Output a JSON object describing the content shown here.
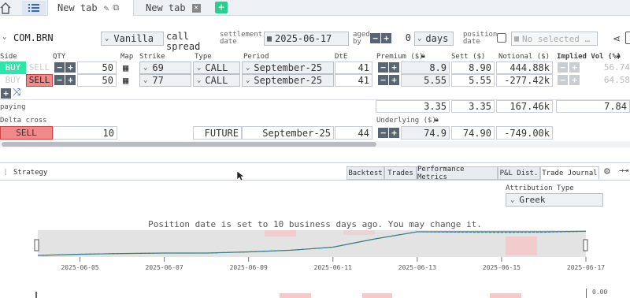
{
  "tabs": [
    {
      "label": "New tab"
    },
    {
      "label": "New tab"
    }
  ],
  "header": {
    "symbol": "COM.BRN",
    "strategy_type": "Vanilla",
    "strategy_name": "call spread",
    "settlement_label": "settlement date",
    "settlement_date": "2025-06-17",
    "aged_label": "aged by",
    "aged_value": "0",
    "aged_unit": "days",
    "position_label": "position date",
    "position_placeholder": "No selected …"
  },
  "columns": {
    "side": "Side",
    "qty": "QTY",
    "map": "Map",
    "strike": "Strike",
    "type": "Type",
    "period": "Period",
    "dte": "DtE",
    "premium": "Premium ($)",
    "sett": "Sett ($)",
    "notional": "Notional ($)",
    "implied_vol": "Implied Vol (%)"
  },
  "legs": [
    {
      "buy": "BUY",
      "sell": "SELL",
      "qty": "50",
      "strike": "69",
      "type": "CALL",
      "period": "September-25",
      "dte": "41",
      "premium": "8.9",
      "sett": "8.90",
      "notional": "444.88k",
      "iv": "56.74"
    },
    {
      "buy": "BUY",
      "sell": "SELL",
      "qty": "50",
      "strike": "77",
      "type": "CALL",
      "period": "September-25",
      "dte": "41",
      "premium": "5.55",
      "sett": "5.55",
      "notional": "-277.42k",
      "iv": "64.58"
    }
  ],
  "summary": {
    "label": "paying",
    "premium": "3.35",
    "sett": "3.35",
    "notional": "167.46k",
    "iv": "7.84"
  },
  "delta": {
    "label": "Delta cross",
    "side": "SELL",
    "qty": "10",
    "type": "FUTURE",
    "period": "September-25",
    "dte": "44",
    "underlying_label": "Underlying ($)",
    "underlying": "74.9",
    "sett": "74.90",
    "notional": "-749.00k"
  },
  "bottom": {
    "section_title": "Strategy",
    "tabs": [
      "Backtest",
      "Trades",
      "Performance Metrics",
      "P&L Dist.",
      "Trade Journal"
    ],
    "active_tab": "Trade Journal",
    "attribution_label": "Attribution Type",
    "attribution_value": "Greek",
    "message": "Position date is set to 10 business days ago. You may change it.",
    "lower_axis_value": "0.00"
  },
  "colors": {
    "buy_active": "#2ee6a8",
    "sell_active": "#f08a8a",
    "accent": "#596573",
    "line_green": "#2f8f3a",
    "line_blue": "#3a6fd0"
  },
  "chart_data": {
    "type": "line",
    "x": [
      "2025-06-04",
      "2025-06-05",
      "2025-06-06",
      "2025-06-07",
      "2025-06-08",
      "2025-06-09",
      "2025-06-10",
      "2025-06-11",
      "2025-06-12",
      "2025-06-13",
      "2025-06-14",
      "2025-06-15",
      "2025-06-16",
      "2025-06-17"
    ],
    "xticks": [
      "2025-06-05",
      "2025-06-07",
      "2025-06-09",
      "2025-06-11",
      "2025-06-13",
      "2025-06-15",
      "2025-06-17"
    ],
    "series": [
      {
        "values": [
          0.0,
          0.05,
          0.08,
          0.1,
          0.1,
          0.15,
          0.22,
          0.35,
          0.7,
          1.0,
          1.0,
          1.0,
          1.0,
          1.02
        ]
      },
      {
        "values": [
          0.0,
          0.05,
          0.08,
          0.1,
          0.1,
          0.15,
          0.22,
          0.35,
          0.7,
          1.0,
          0.98,
          0.97,
          0.98,
          1.02
        ]
      }
    ]
  }
}
